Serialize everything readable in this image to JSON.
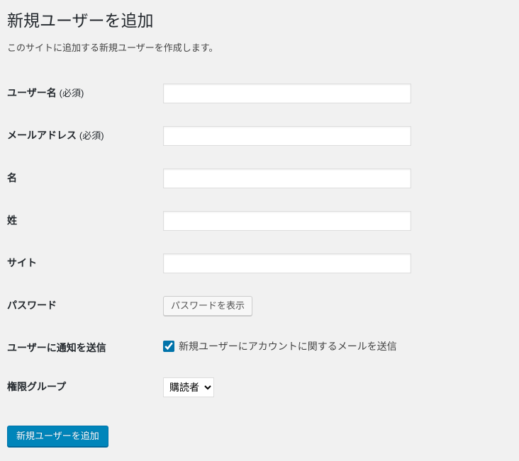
{
  "page_title": "新規ユーザーを追加",
  "page_description": "このサイトに追加する新規ユーザーを作成します。",
  "fields": {
    "username": {
      "label": "ユーザー名",
      "required": "(必須)",
      "value": ""
    },
    "email": {
      "label": "メールアドレス",
      "required": "(必須)",
      "value": ""
    },
    "first_name": {
      "label": "名",
      "value": ""
    },
    "last_name": {
      "label": "姓",
      "value": ""
    },
    "website": {
      "label": "サイト",
      "value": ""
    },
    "password": {
      "label": "パスワード",
      "button": "パスワードを表示"
    },
    "send_notification": {
      "label": "ユーザーに通知を送信",
      "checkbox_label": "新規ユーザーにアカウントに関するメールを送信",
      "checked": true
    },
    "role": {
      "label": "権限グループ",
      "selected": "購読者"
    }
  },
  "submit_button": "新規ユーザーを追加"
}
